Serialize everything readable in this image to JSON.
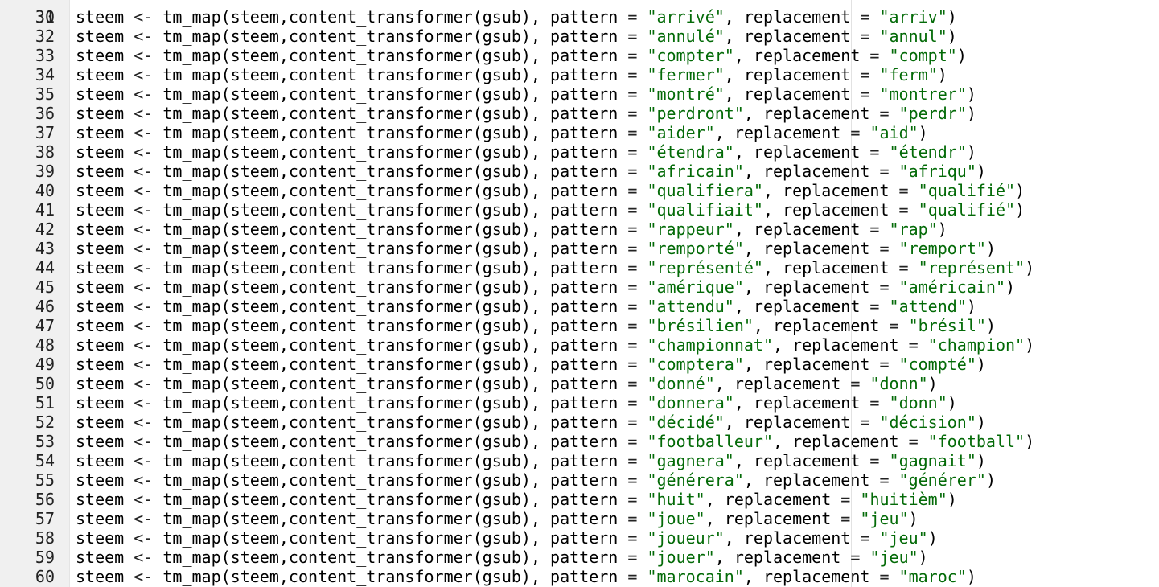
{
  "editor": {
    "first_line_number": "30",
    "lines": [
      {
        "n": "31",
        "pattern": "arrivé",
        "replacement": "arriv"
      },
      {
        "n": "32",
        "pattern": "annulé",
        "replacement": "annul"
      },
      {
        "n": "33",
        "pattern": "compter",
        "replacement": "compt"
      },
      {
        "n": "34",
        "pattern": "fermer",
        "replacement": "ferm"
      },
      {
        "n": "35",
        "pattern": "montré",
        "replacement": "montrer"
      },
      {
        "n": "36",
        "pattern": "perdront",
        "replacement": "perdr"
      },
      {
        "n": "37",
        "pattern": "aider",
        "replacement": "aid"
      },
      {
        "n": "38",
        "pattern": "étendra",
        "replacement": "étendr"
      },
      {
        "n": "39",
        "pattern": "africain",
        "replacement": "afriqu"
      },
      {
        "n": "40",
        "pattern": "qualifiera",
        "replacement": "qualifié"
      },
      {
        "n": "41",
        "pattern": "qualifiait",
        "replacement": "qualifié"
      },
      {
        "n": "42",
        "pattern": "rappeur",
        "replacement": "rap"
      },
      {
        "n": "43",
        "pattern": "remporté",
        "replacement": "remport"
      },
      {
        "n": "44",
        "pattern": "représenté",
        "replacement": "représent"
      },
      {
        "n": "45",
        "pattern": "amérique",
        "replacement": "américain"
      },
      {
        "n": "46",
        "pattern": "attendu",
        "replacement": "attend"
      },
      {
        "n": "47",
        "pattern": "brésilien",
        "replacement": "brésil"
      },
      {
        "n": "48",
        "pattern": "championnat",
        "replacement": "champion"
      },
      {
        "n": "49",
        "pattern": "comptera",
        "replacement": "compté"
      },
      {
        "n": "50",
        "pattern": "donné",
        "replacement": "donn"
      },
      {
        "n": "51",
        "pattern": "donnera",
        "replacement": "donn"
      },
      {
        "n": "52",
        "pattern": "décidé",
        "replacement": "décision"
      },
      {
        "n": "53",
        "pattern": "footballeur",
        "replacement": "football"
      },
      {
        "n": "54",
        "pattern": "gagnera",
        "replacement": "gagnait"
      },
      {
        "n": "55",
        "pattern": "générera",
        "replacement": "générer"
      },
      {
        "n": "56",
        "pattern": "huit",
        "replacement": "huitièm"
      },
      {
        "n": "57",
        "pattern": "joue",
        "replacement": "jeu"
      },
      {
        "n": "58",
        "pattern": "joueur",
        "replacement": "jeu"
      },
      {
        "n": "59",
        "pattern": "jouer",
        "replacement": "jeu"
      },
      {
        "n": "60",
        "pattern": "marocain",
        "replacement": "maroc"
      }
    ]
  },
  "colors": {
    "string": "#036a07",
    "keyword": "#000000",
    "gutter_bg": "#f0f0f0"
  }
}
